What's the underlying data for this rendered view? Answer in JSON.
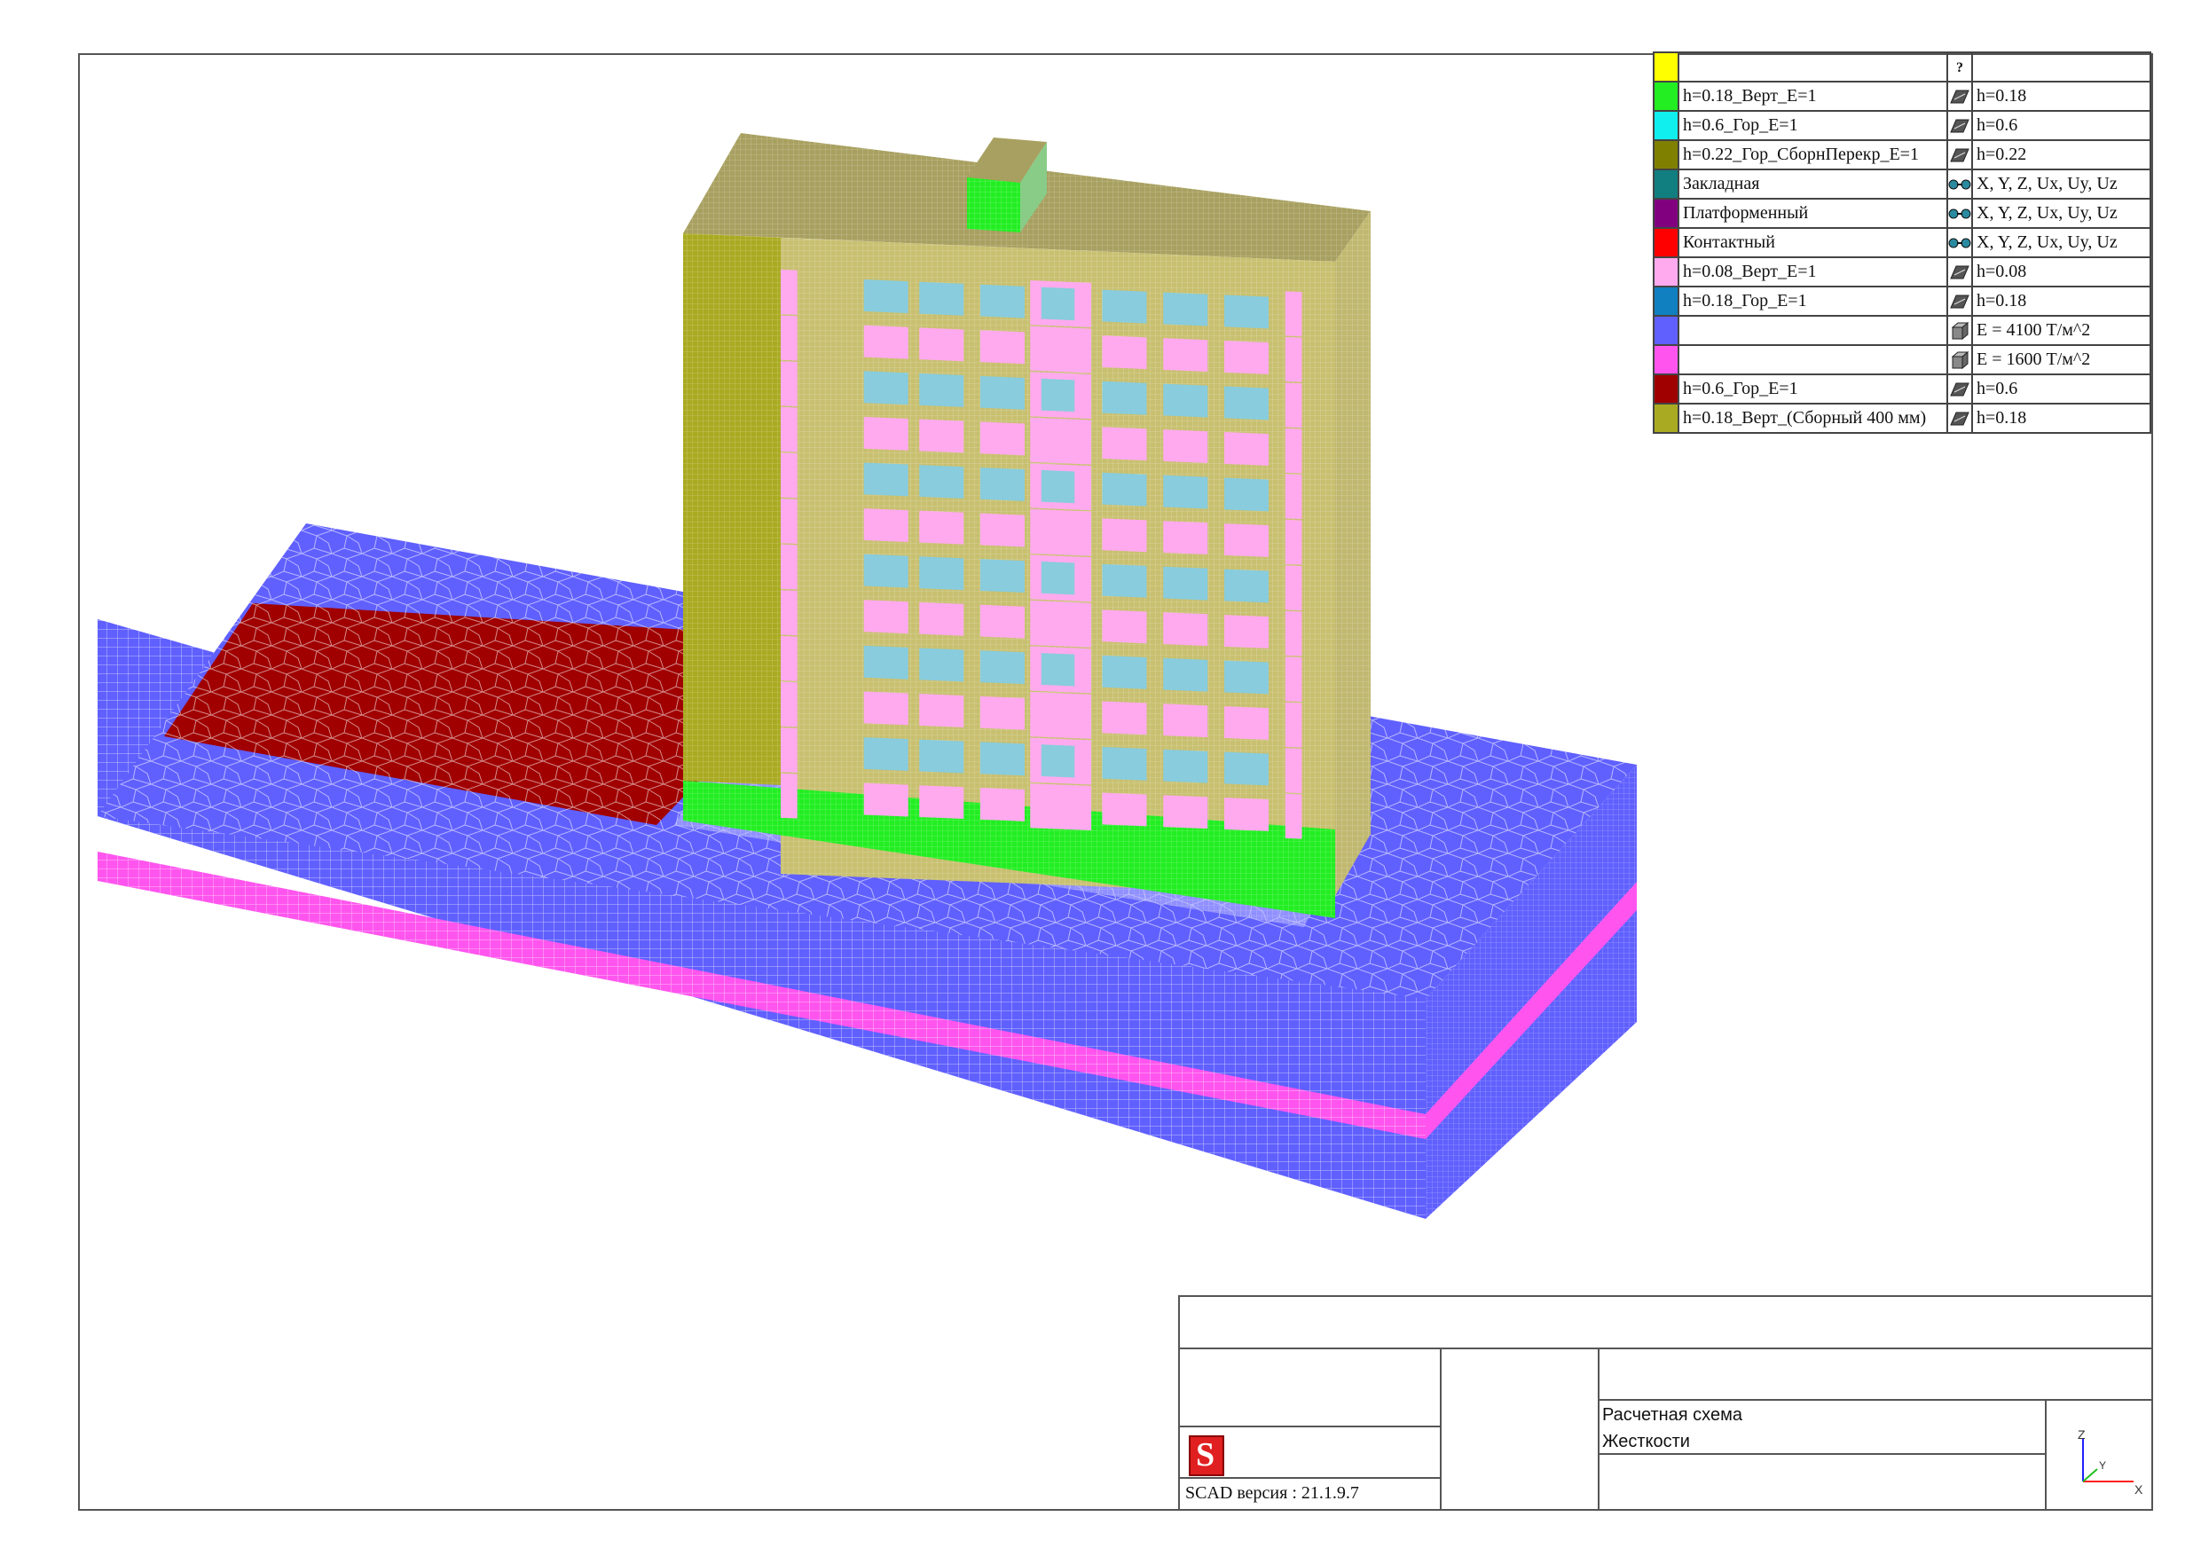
{
  "legend": [
    {
      "color": "#ffff00",
      "name": "",
      "icon": "question-mark-icon",
      "icon_text": "?",
      "value": ""
    },
    {
      "color": "#22ee22",
      "name": "h=0.18_Верт_E=1",
      "icon": "plate-icon",
      "value": "h=0.18"
    },
    {
      "color": "#11eeee",
      "name": "h=0.6_Гор_E=1",
      "icon": "plate-icon",
      "value": "h=0.6"
    },
    {
      "color": "#808000",
      "name": "h=0.22_Гор_СборнПерекр_E=1",
      "icon": "plate-icon",
      "value": "h=0.22"
    },
    {
      "color": "#117f80",
      "name": "Закладная",
      "icon": "link-element-icon",
      "value": "X, Y, Z, Ux, Uy, Uz"
    },
    {
      "color": "#800080",
      "name": "Платформенный",
      "icon": "link-element-icon",
      "value": "X, Y, Z, Ux, Uy, Uz"
    },
    {
      "color": "#ff0000",
      "name": "Контактный",
      "icon": "link-element-icon",
      "value": "X, Y, Z, Ux, Uy, Uz"
    },
    {
      "color": "#ffaaee",
      "name": "h=0.08_Верт_E=1",
      "icon": "plate-icon",
      "value": "h=0.08"
    },
    {
      "color": "#1080c0",
      "name": "h=0.18_Гор_E=1",
      "icon": "plate-icon",
      "value": "h=0.18"
    },
    {
      "color": "#6060ff",
      "name": "",
      "icon": "solid-element-icon",
      "value": "E = 4100 Т/м^2"
    },
    {
      "color": "#ff55ee",
      "name": "",
      "icon": "solid-element-icon",
      "value": "E = 1600 Т/м^2"
    },
    {
      "color": "#a00000",
      "name": "h=0.6_Гор_E=1",
      "icon": "plate-icon",
      "value": "h=0.6"
    },
    {
      "color": "#aaaa22",
      "name": "h=0.18_Верт_(Сборный 400 мм)",
      "icon": "plate-icon",
      "value": "h=0.18"
    }
  ],
  "title_block": {
    "scheme_label": "Расчетная схема",
    "scheme_name": "Жесткости",
    "version": "SCAD версия : 21.1.9.7",
    "logo_letter": "S"
  },
  "axes": {
    "x": "X",
    "y": "Y",
    "z": "Z"
  },
  "colors": {
    "soil": "#6060ff",
    "soil_layer": "#ff55ee",
    "slab_red": "#a00000",
    "wall_olive": "#aaaa22",
    "roof": "#a8a060",
    "partition_pink": "#ffaaee",
    "base_green": "#22ee22",
    "window_cyan": "#88ccdd"
  }
}
